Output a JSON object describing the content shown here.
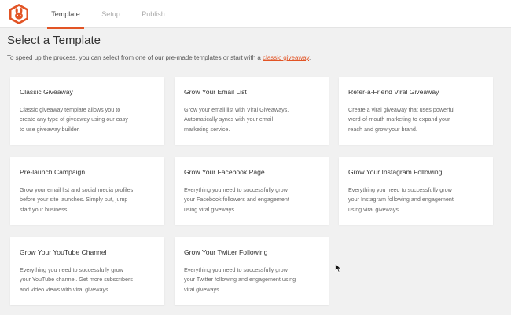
{
  "header": {
    "logo_icon": "rafflepress-bunny-icon",
    "brand_color": "#e25425",
    "tabs": [
      {
        "label": "Template",
        "active": true
      },
      {
        "label": "Setup",
        "active": false
      },
      {
        "label": "Publish",
        "active": false
      }
    ]
  },
  "main": {
    "title": "Select a Template",
    "subtitle_prefix": "To speed up the process, you can select from one of our pre-made templates or start with a ",
    "subtitle_link": "classic giveaway",
    "subtitle_suffix": ".",
    "templates": [
      {
        "title": "Classic Giveaway",
        "lines": [
          "Classic giveaway template allows you to",
          "create any type of giveaway using our easy",
          "to use giveaway builder."
        ]
      },
      {
        "title": "Grow Your Email List",
        "lines": [
          "Grow your email list with Viral Giveaways.",
          "Automatically syncs with your email",
          "marketing service."
        ]
      },
      {
        "title": "Refer-a-Friend Viral Giveaway",
        "lines": [
          "Create a viral giveaway that uses powerful",
          "word-of-mouth marketing to expand your",
          "reach and grow your brand."
        ]
      },
      {
        "title": "Pre-launch Campaign",
        "lines": [
          "Grow your email list and social media profiles",
          "before your site launches. Simply put, jump",
          "start your business."
        ]
      },
      {
        "title": "Grow Your Facebook Page",
        "lines": [
          "Everything you need to successfully grow",
          "your Facebook followers and engagement",
          "using viral giveways."
        ]
      },
      {
        "title": "Grow Your Instagram Following",
        "lines": [
          "Everything you need to successfully grow",
          "your Instagram following and engagement",
          "using viral giveways."
        ]
      },
      {
        "title": "Grow Your YouTube Channel",
        "lines": [
          "Everything you need to successfully grow",
          "your YouTube channel. Get more subscribers",
          "and video views with viral giveways."
        ]
      },
      {
        "title": "Grow Your Twitter Following",
        "lines": [
          "Everything you need to successfully grow",
          "your Twitter following and engagement using",
          "viral giveways."
        ]
      }
    ]
  }
}
